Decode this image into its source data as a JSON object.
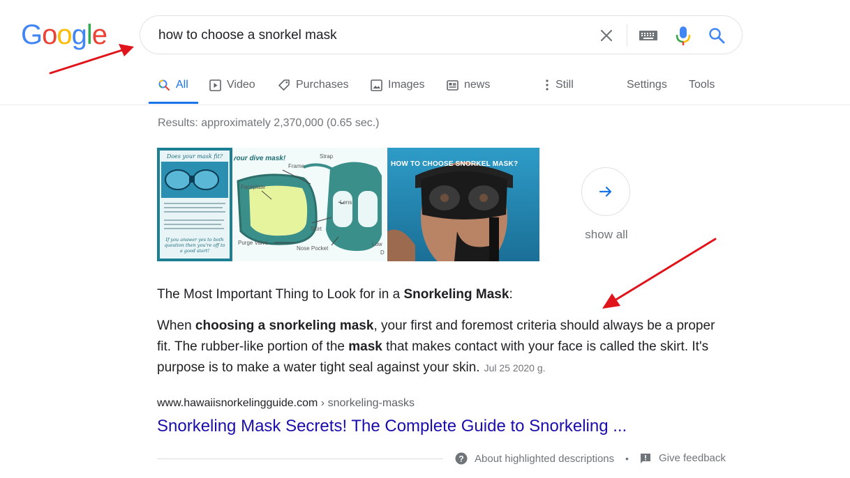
{
  "logo": {
    "letters": [
      "G",
      "o",
      "o",
      "g",
      "l",
      "e"
    ],
    "colors": [
      "#4285f4",
      "#ea4335",
      "#fbbc05",
      "#4285f4",
      "#34a853",
      "#ea4335"
    ]
  },
  "search": {
    "query": "how to choose a snorkel mask"
  },
  "tabs": [
    {
      "label": "All",
      "icon": "search-icon"
    },
    {
      "label": "Video",
      "icon": "play-icon"
    },
    {
      "label": "Purchases",
      "icon": "tag-icon"
    },
    {
      "label": "Images",
      "icon": "image-icon"
    },
    {
      "label": "news",
      "icon": "news-icon"
    },
    {
      "label": "Still",
      "icon": "more-vert-icon"
    }
  ],
  "settings_label": "Settings",
  "tools_label": "Tools",
  "result_stats": "Results: approximately 2,370,000 (0.65 sec.)",
  "images": {
    "thumb1_title": "Does your mask fit?",
    "thumb1_text": "If you answer yes to both question then you're off to a good start!",
    "thumb2_title": "your dive mask!",
    "thumb2_labels": [
      "Strap",
      "Frame",
      "Faceplate",
      "Lens",
      "Skirt",
      "Purge Valve",
      "Nose Pocket",
      "Low",
      "D"
    ],
    "thumb3_title": "HOW TO CHOOSE SNORKEL MASK?",
    "show_all": "show all"
  },
  "snippet": {
    "heading_plain": "The Most Important Thing to Look for in a ",
    "heading_bold": "Snorkeling Mask",
    "heading_end": ":",
    "p1": "When ",
    "b1": "choosing a snorkeling mask",
    "p2": ", your first and foremost criteria should always be a proper fit. The rubber-like portion of the ",
    "b2": "mask",
    "p3": " that makes contact with your face is called the skirt. It's purpose is to make a water tight seal against your skin.",
    "date": "Jul 25 2020 g."
  },
  "result": {
    "domain": "www.hawaiisnorkelingguide.com",
    "crumb": " › snorkeling-masks",
    "title": "Snorkeling Mask Secrets! The Complete Guide to Snorkeling ..."
  },
  "footer": {
    "about": "About highlighted descriptions",
    "dot": "•",
    "feedback": "Give feedback"
  },
  "colors": {
    "accent": "#1a73e8",
    "link": "#1a0dab",
    "annotation_arrow": "#e0141b"
  }
}
